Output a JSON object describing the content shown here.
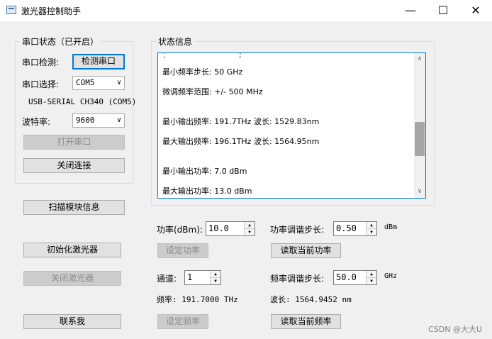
{
  "window": {
    "title": "激光器控制助手",
    "minimize": "—",
    "maximize": "☐",
    "close": "✕"
  },
  "serial": {
    "group_title": "串口状态（已开启）",
    "detect_label": "串口检测:",
    "detect_button": "检测串口",
    "select_label": "串口选择:",
    "port_value": "COM5",
    "device_desc": "USB-SERIAL CH340 (COM5)",
    "baud_label": "波特率:",
    "baud_value": "9600",
    "open_button": "打开串口",
    "close_button": "关闭连接"
  },
  "buttons": {
    "scan_module": "扫描模块信息",
    "init_laser": "初始化激光器",
    "close_laser": "关闭激光器",
    "contact": "联系我"
  },
  "status": {
    "group_title": "状态信息",
    "lines": [
      "最小频率步长: 50 GHz",
      "微调频率范围: +/- 500 MHz",
      "",
      "最小输出频率: 191.7THz  波长: 1529.83nm",
      "最大输出频率: 196.1THz  波长: 1564.95nm",
      "",
      "最小输出功率: 7.0 dBm",
      "最大输出功率: 13.0 dBm"
    ]
  },
  "power": {
    "label": "功率(dBm):",
    "value": "10.0",
    "step_label": "功率调谐步长:",
    "step_value": "0.50",
    "step_unit": "dBm",
    "set_button": "设定功率",
    "read_button": "读取当前功率"
  },
  "channel": {
    "label": "通道:",
    "value": "1",
    "step_label": "频率调谐步长:",
    "step_value": "50.0",
    "step_unit": "GHz",
    "freq_text": "频率: 191.7000 THz",
    "wavelength_text": "波长: 1564.9452 nm",
    "set_button": "设定频率",
    "read_button": "读取当前频率"
  },
  "watermark": "CSDN @大大U"
}
